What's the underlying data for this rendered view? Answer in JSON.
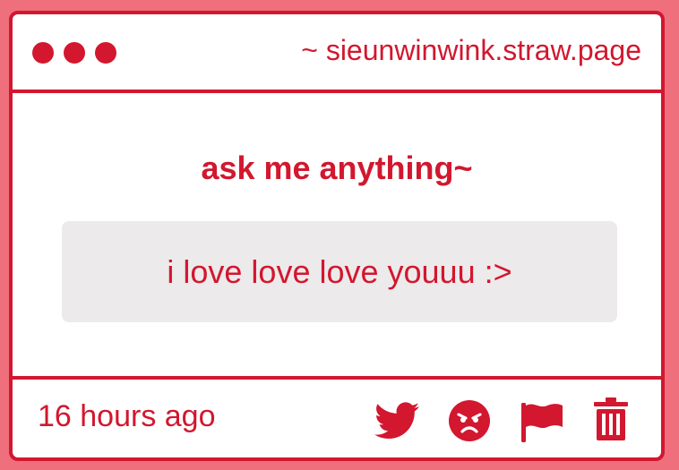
{
  "window": {
    "url": "~ sieunwinwink.straw.page",
    "dots": 3
  },
  "content": {
    "prompt": "ask me anything~",
    "answer": "i love love love youuu :>"
  },
  "footer": {
    "timestamp": "16 hours ago",
    "actions": [
      "twitter-icon",
      "angry-face-icon",
      "flag-icon",
      "trash-icon"
    ]
  },
  "colors": {
    "accent": "#d2172f",
    "background": "#ef6f7d",
    "answer_box": "#eceaeb"
  }
}
